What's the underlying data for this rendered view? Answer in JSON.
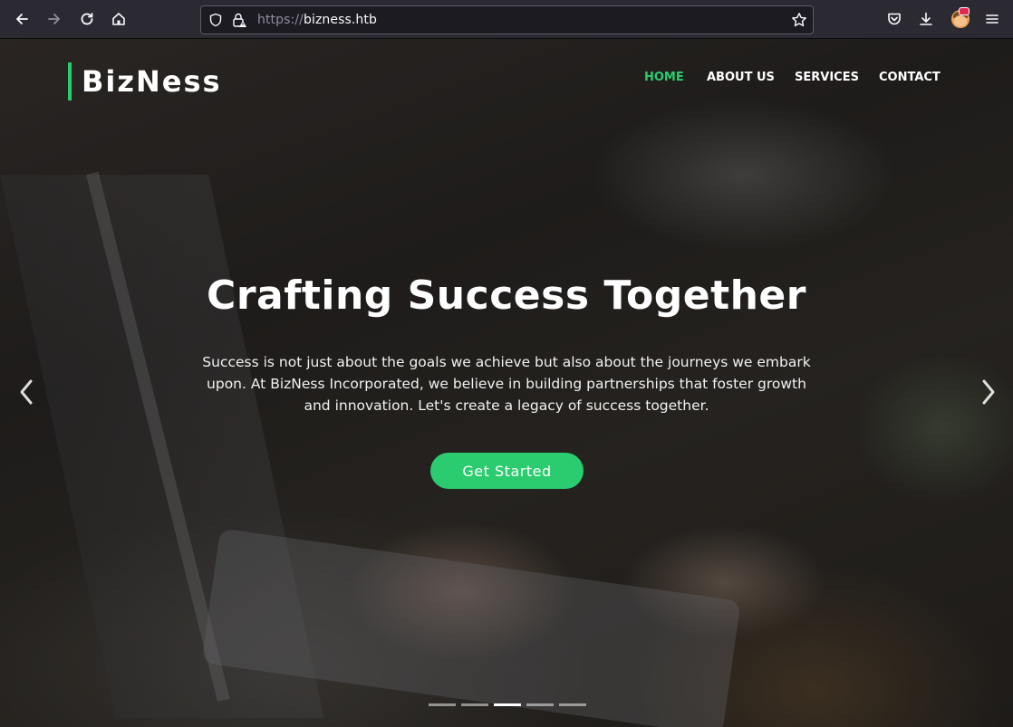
{
  "browser": {
    "url_scheme": "https://",
    "url_host": "bizness.htb",
    "icons": [
      "back-icon",
      "forward-icon",
      "reload-icon",
      "home-icon",
      "shield-icon",
      "lock-icon",
      "star-icon",
      "pocket-icon",
      "download-icon",
      "extension-icon",
      "menu-icon"
    ]
  },
  "site": {
    "brand": "BizNess",
    "accent_color": "#2bcc6f",
    "nav": [
      {
        "label": "HOME",
        "active": true
      },
      {
        "label": "ABOUT US",
        "active": false
      },
      {
        "label": "SERVICES",
        "active": false
      },
      {
        "label": "CONTACT",
        "active": false
      }
    ]
  },
  "hero": {
    "title": "Crafting Success Together",
    "text": "Success is not just about the goals we achieve but also about the journeys we embark upon. At BizNess Incorporated, we believe in building partnerships that foster growth and innovation. Let's create a legacy of success together.",
    "cta": "Get Started",
    "slides_total": 5,
    "active_slide": 3
  }
}
